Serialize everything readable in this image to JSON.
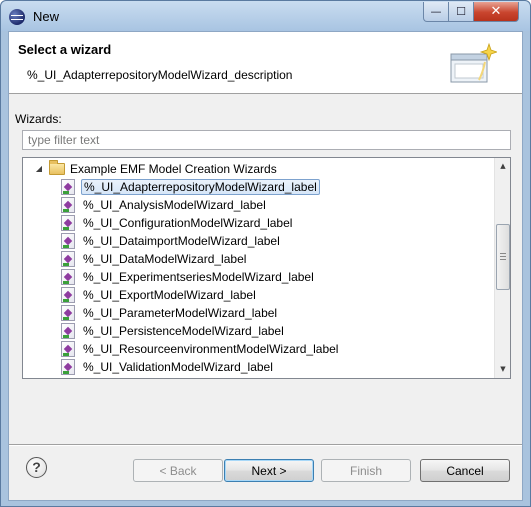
{
  "window": {
    "title": "New",
    "buttons": {
      "minimize": "—",
      "maximize": "☐",
      "close": "✕"
    }
  },
  "banner": {
    "title": "Select a wizard",
    "description": "%_UI_AdapterrepositoryModelWizard_description",
    "graphic_icon": "new-wizard-sparkle-icon"
  },
  "wizards_label": "Wizards:",
  "filter": {
    "placeholder": "type filter text",
    "value": ""
  },
  "tree": {
    "category": {
      "label": "Example EMF Model Creation Wizards",
      "expanded": true,
      "icon": "folder-open-icon"
    },
    "items": [
      {
        "label": "%_UI_AdapterrepositoryModelWizard_label",
        "selected": true
      },
      {
        "label": "%_UI_AnalysisModelWizard_label",
        "selected": false
      },
      {
        "label": "%_UI_ConfigurationModelWizard_label",
        "selected": false
      },
      {
        "label": "%_UI_DataimportModelWizard_label",
        "selected": false
      },
      {
        "label": "%_UI_DataModelWizard_label",
        "selected": false
      },
      {
        "label": "%_UI_ExperimentseriesModelWizard_label",
        "selected": false
      },
      {
        "label": "%_UI_ExportModelWizard_label",
        "selected": false
      },
      {
        "label": "%_UI_ParameterModelWizard_label",
        "selected": false
      },
      {
        "label": "%_UI_PersistenceModelWizard_label",
        "selected": false
      },
      {
        "label": "%_UI_ResourceenvironmentModelWizard_label",
        "selected": false
      },
      {
        "label": "%_UI_ValidationModelWizard_label",
        "selected": false
      }
    ],
    "item_icon": "emf-model-file-icon"
  },
  "buttons": {
    "back": "< Back",
    "next": "Next >",
    "finish": "Finish",
    "cancel": "Cancel"
  },
  "colors": {
    "titlebar": "#a8c4e2",
    "close_button": "#c9452e",
    "selection": "#d6e6f8",
    "default_button_border": "#3c7fb1"
  }
}
